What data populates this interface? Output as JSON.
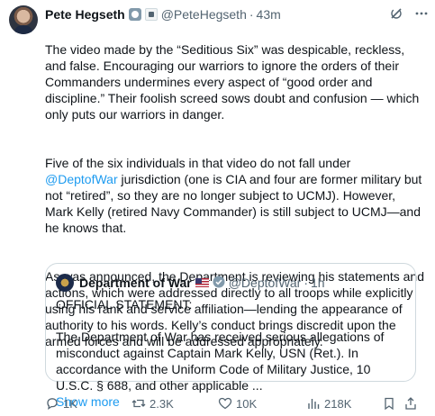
{
  "author": {
    "name": "Pete Hegseth",
    "handle": "@PeteHegseth",
    "separator": "·",
    "time": "43m"
  },
  "tweet": {
    "para1": "The video made by the “Seditious Six” was despicable, reckless, and false. Encouraging our warriors to ignore the orders of their Commanders undermines every aspect of “good order and discipline.” Their foolish screed sows doubt and confusion — which only puts our warriors in danger.",
    "para2_before": "Five of the six individuals in that video do not fall under ",
    "para2_mention": "@DeptofWar",
    "para2_after": " jurisdiction (one is CIA and four are former military but not “retired”, so they are no longer subject to UCMJ). However, Mark Kelly (retired Navy Commander) is still subject to UCMJ—and he knows that.",
    "para3": "As was announced, the Department is reviewing his statements and actions, which were addressed directly to all troops while explicitly using his rank and service affiliation—lending the appearance of authority to his words. Kelly’s conduct brings discredit upon the armed forces and will be addressed appropriately."
  },
  "quote": {
    "name": "Department of War",
    "handle": "@DeptofWar",
    "separator": "·",
    "time": "1h",
    "line1": "OFFICIAL STATEMENT:",
    "line2": "The Department of War has received serious allegations of misconduct against Captain Mark Kelly, USN (Ret.). In accordance with the Uniform Code of Military Justice, 10 U.S.C. § 688, and other applicable ...",
    "show_more": "Show more"
  },
  "actions": {
    "replies": "1K",
    "reposts": "2.3K",
    "likes": "10K",
    "views": "218K"
  },
  "icons": {
    "grok": "grok-icon",
    "more": "more-icon",
    "reply": "reply-icon",
    "repost": "repost-icon",
    "like": "like-icon",
    "views": "views-icon",
    "bookmark": "bookmark-icon",
    "share": "share-icon"
  },
  "colors": {
    "accent": "#1d9bf0",
    "secondary_text": "#536471",
    "border": "#cfd9de",
    "gov_badge": "#829aab"
  }
}
